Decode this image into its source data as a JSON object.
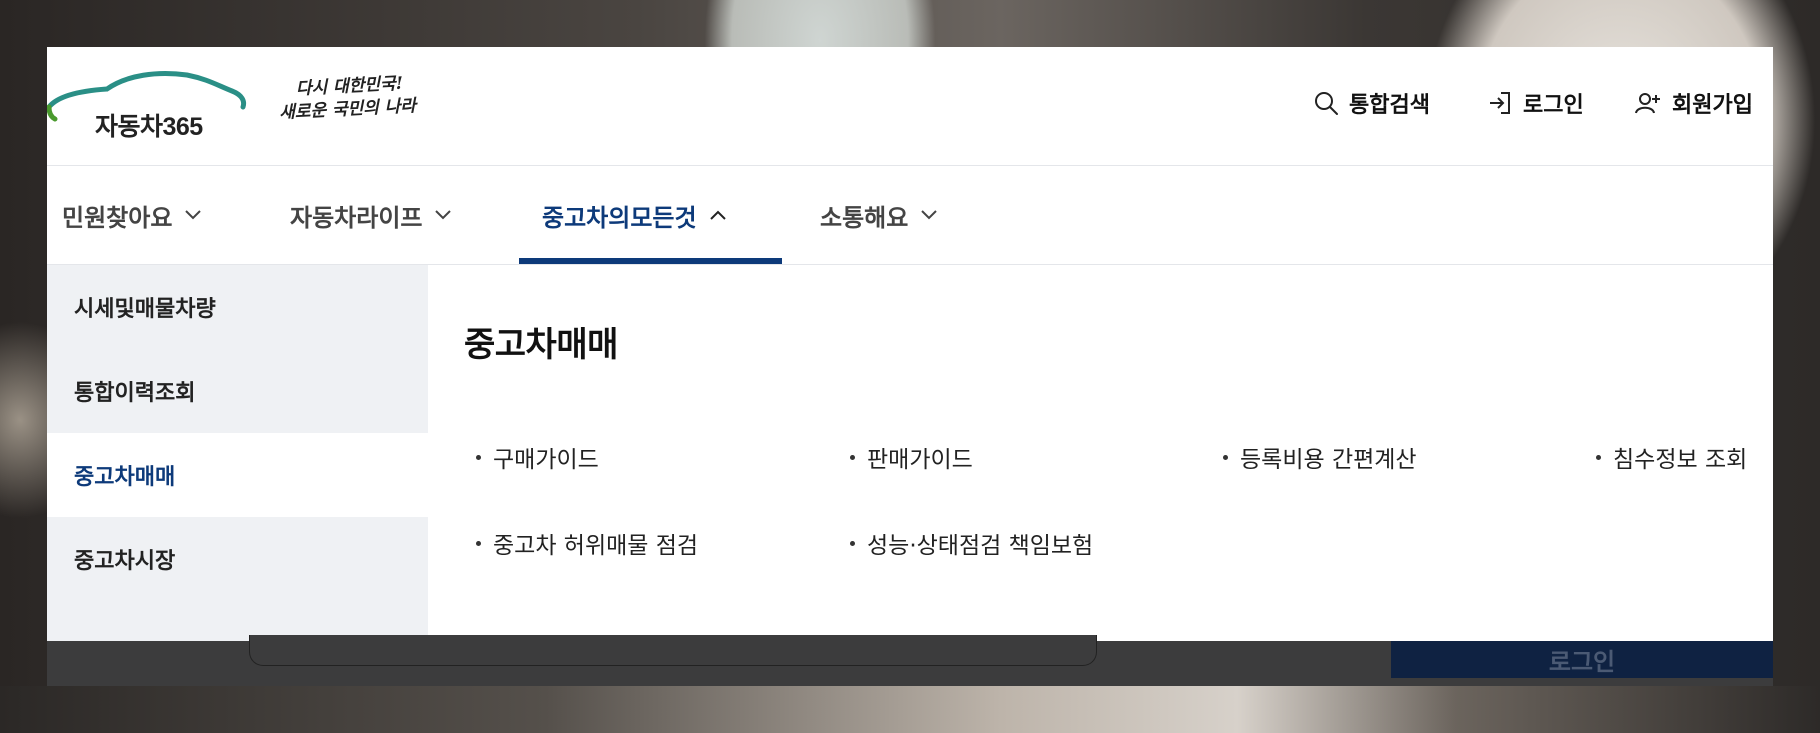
{
  "brand": {
    "logo_text": "자동차365",
    "slogan_line1": "다시 대한민국!",
    "slogan_line2": "새로운 국민의 나라",
    "colors": {
      "logo_teal": "#2a8f86",
      "logo_green": "#4a9a2e"
    }
  },
  "utility": {
    "search": {
      "label": "통합검색",
      "icon": "search-icon"
    },
    "login": {
      "label": "로그인",
      "icon": "login-icon"
    },
    "join": {
      "label": "회원가입",
      "icon": "user-add-icon"
    }
  },
  "nav": {
    "items": [
      {
        "label": "민원찾아요",
        "expanded": false
      },
      {
        "label": "자동차라이프",
        "expanded": false
      },
      {
        "label": "중고차의모든것",
        "expanded": true
      },
      {
        "label": "소통해요",
        "expanded": false
      }
    ],
    "accent_color": "#0d3a7a"
  },
  "submenu": {
    "items": [
      {
        "label": "시세및매물차량",
        "active": false
      },
      {
        "label": "통합이력조회",
        "active": false
      },
      {
        "label": "중고차매매",
        "active": true
      },
      {
        "label": "중고차시장",
        "active": false
      }
    ]
  },
  "content": {
    "title": "중고차매매",
    "links": [
      "구매가이드",
      "판매가이드",
      "등록비용 간편계산",
      "침수정보 조회",
      "중고차 허위매물 점검",
      "성능·상태점검 책임보험"
    ]
  },
  "underlay": {
    "button_label": "로그인"
  }
}
